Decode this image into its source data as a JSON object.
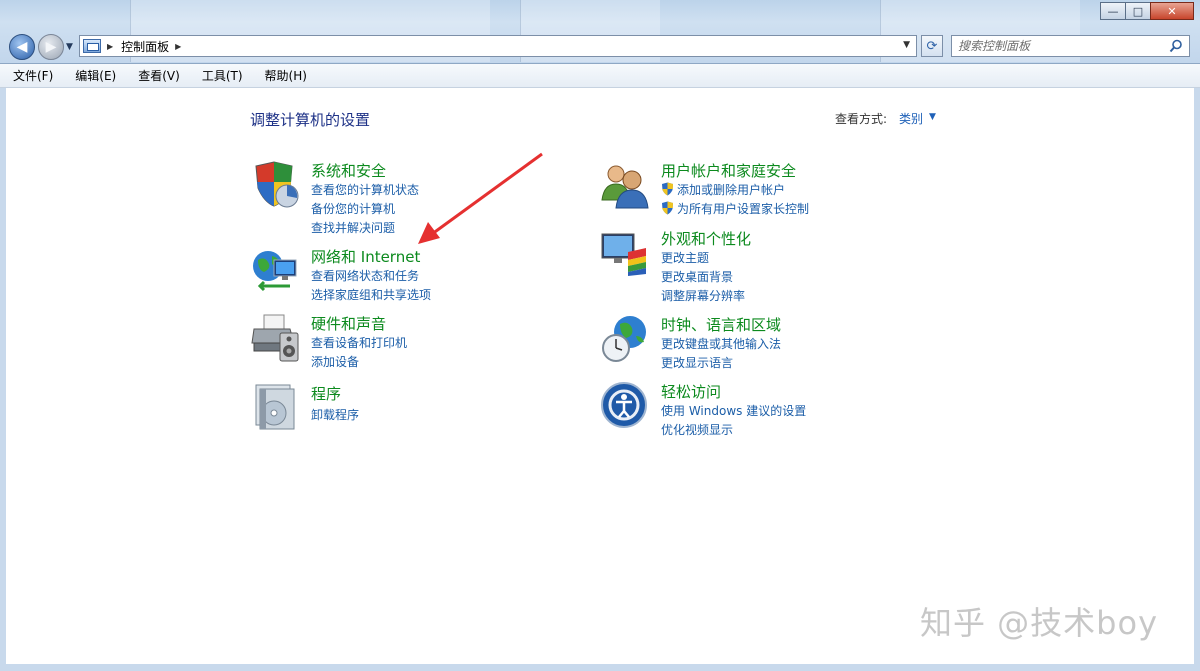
{
  "window": {
    "buttons": {
      "minimize": "—",
      "maximize": "□",
      "close": "✕"
    }
  },
  "address": {
    "crumbs": [
      "控制面板"
    ],
    "search_placeholder": "搜索控制面板"
  },
  "menu": [
    "文件(F)",
    "编辑(E)",
    "查看(V)",
    "工具(T)",
    "帮助(H)"
  ],
  "content": {
    "heading": "调整计算机的设置",
    "view_by_label": "查看方式:",
    "view_by_value": "类别"
  },
  "categories": [
    {
      "title": "系统和安全",
      "icon": "shield-icon",
      "links": [
        "查看您的计算机状态",
        "备份您的计算机",
        "查找并解决问题"
      ]
    },
    {
      "title": "网络和 Internet",
      "icon": "network-globe-icon",
      "links": [
        "查看网络状态和任务",
        "选择家庭组和共享选项"
      ]
    },
    {
      "title": "硬件和声音",
      "icon": "printer-speaker-icon",
      "links": [
        "查看设备和打印机",
        "添加设备"
      ]
    },
    {
      "title": "程序",
      "icon": "programs-disc-icon",
      "links": [
        "卸载程序"
      ]
    },
    {
      "title": "用户帐户和家庭安全",
      "icon": "users-icon",
      "links": [
        "添加或删除用户帐户",
        "为所有用户设置家长控制"
      ]
    },
    {
      "title": "外观和个性化",
      "icon": "monitor-palette-icon",
      "links": [
        "更改主题",
        "更改桌面背景",
        "调整屏幕分辨率"
      ]
    },
    {
      "title": "时钟、语言和区域",
      "icon": "clock-globe-icon",
      "links": [
        "更改键盘或其他输入法",
        "更改显示语言"
      ]
    },
    {
      "title": "轻松访问",
      "icon": "ease-of-access-icon",
      "links": [
        "使用 Windows 建议的设置",
        "优化视频显示"
      ]
    }
  ],
  "watermark": "知乎 @技术boy",
  "colors": {
    "category_title": "#0c8a1e",
    "link": "#1c5ea8",
    "heading": "#1e3287",
    "annotation_arrow": "#e53030"
  }
}
